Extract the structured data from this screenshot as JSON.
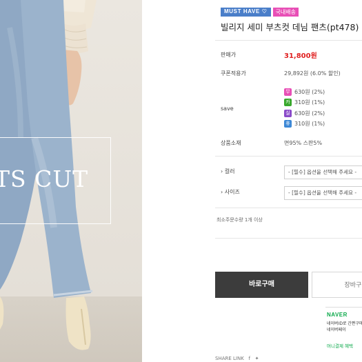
{
  "photo": {
    "overlay_text": "TS CUT"
  },
  "badges": {
    "must_have": "MUST HAVE ♡",
    "domestic": "국내배송"
  },
  "product": {
    "title": "빌리지 세미 부츠컷 데님 팬츠(pt478)"
  },
  "details": {
    "price_label": "판매가",
    "price_value": "31,800원",
    "coupon_label": "쿠폰적용가",
    "coupon_value": "29,892원 (6.0% 할인)",
    "save_label": "save",
    "save_items": [
      {
        "icon": "무",
        "color": "#e84fb6",
        "text": "630원 (2%)"
      },
      {
        "icon": "카",
        "color": "#38a82c",
        "text": "310원 (1%)"
      },
      {
        "icon": "실",
        "color": "#8a4bc9",
        "text": "630원 (2%)"
      },
      {
        "icon": "휴",
        "color": "#3d88d6",
        "text": "310원 (1%)"
      }
    ],
    "material_label": "상품소재",
    "material_value": "면95% 스판5%"
  },
  "options": {
    "color_label": "컬러",
    "color_placeholder": "- [필수] 옵션을 선택해 주세요 -",
    "size_label": "사이즈",
    "size_placeholder": "- [필수] 옵션을 선택해 주세요 -",
    "min_qty": "최소주문수량 1개 이상"
  },
  "actions": {
    "buy_now": "바로구매",
    "cart": "장바구니"
  },
  "naver": {
    "logo": "NAVER",
    "line1": "네이버ID로 간편구매",
    "line2": "네이버페이",
    "line3": "머니결제 혜택"
  },
  "share": {
    "label": "SHARE LINK"
  }
}
